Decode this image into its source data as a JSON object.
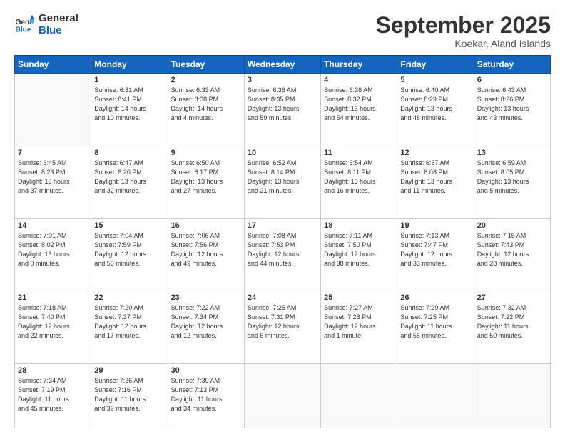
{
  "logo": {
    "line1": "General",
    "line2": "Blue"
  },
  "header": {
    "month": "September 2025",
    "location": "Koekar, Aland Islands"
  },
  "weekdays": [
    "Sunday",
    "Monday",
    "Tuesday",
    "Wednesday",
    "Thursday",
    "Friday",
    "Saturday"
  ],
  "weeks": [
    [
      {
        "day": "",
        "info": ""
      },
      {
        "day": "1",
        "info": "Sunrise: 6:31 AM\nSunset: 8:41 PM\nDaylight: 14 hours\nand 10 minutes."
      },
      {
        "day": "2",
        "info": "Sunrise: 6:33 AM\nSunset: 8:38 PM\nDaylight: 14 hours\nand 4 minutes."
      },
      {
        "day": "3",
        "info": "Sunrise: 6:36 AM\nSunset: 8:35 PM\nDaylight: 13 hours\nand 59 minutes."
      },
      {
        "day": "4",
        "info": "Sunrise: 6:38 AM\nSunset: 8:32 PM\nDaylight: 13 hours\nand 54 minutes."
      },
      {
        "day": "5",
        "info": "Sunrise: 6:40 AM\nSunset: 8:29 PM\nDaylight: 13 hours\nand 48 minutes."
      },
      {
        "day": "6",
        "info": "Sunrise: 6:43 AM\nSunset: 8:26 PM\nDaylight: 13 hours\nand 43 minutes."
      }
    ],
    [
      {
        "day": "7",
        "info": "Sunrise: 6:45 AM\nSunset: 8:23 PM\nDaylight: 13 hours\nand 37 minutes."
      },
      {
        "day": "8",
        "info": "Sunrise: 6:47 AM\nSunset: 8:20 PM\nDaylight: 13 hours\nand 32 minutes."
      },
      {
        "day": "9",
        "info": "Sunrise: 6:50 AM\nSunset: 8:17 PM\nDaylight: 13 hours\nand 27 minutes."
      },
      {
        "day": "10",
        "info": "Sunrise: 6:52 AM\nSunset: 8:14 PM\nDaylight: 13 hours\nand 21 minutes."
      },
      {
        "day": "11",
        "info": "Sunrise: 6:54 AM\nSunset: 8:11 PM\nDaylight: 13 hours\nand 16 minutes."
      },
      {
        "day": "12",
        "info": "Sunrise: 6:57 AM\nSunset: 8:08 PM\nDaylight: 13 hours\nand 11 minutes."
      },
      {
        "day": "13",
        "info": "Sunrise: 6:59 AM\nSunset: 8:05 PM\nDaylight: 13 hours\nand 5 minutes."
      }
    ],
    [
      {
        "day": "14",
        "info": "Sunrise: 7:01 AM\nSunset: 8:02 PM\nDaylight: 13 hours\nand 0 minutes."
      },
      {
        "day": "15",
        "info": "Sunrise: 7:04 AM\nSunset: 7:59 PM\nDaylight: 12 hours\nand 55 minutes."
      },
      {
        "day": "16",
        "info": "Sunrise: 7:06 AM\nSunset: 7:56 PM\nDaylight: 12 hours\nand 49 minutes."
      },
      {
        "day": "17",
        "info": "Sunrise: 7:08 AM\nSunset: 7:53 PM\nDaylight: 12 hours\nand 44 minutes."
      },
      {
        "day": "18",
        "info": "Sunrise: 7:11 AM\nSunset: 7:50 PM\nDaylight: 12 hours\nand 38 minutes."
      },
      {
        "day": "19",
        "info": "Sunrise: 7:13 AM\nSunset: 7:47 PM\nDaylight: 12 hours\nand 33 minutes."
      },
      {
        "day": "20",
        "info": "Sunrise: 7:15 AM\nSunset: 7:43 PM\nDaylight: 12 hours\nand 28 minutes."
      }
    ],
    [
      {
        "day": "21",
        "info": "Sunrise: 7:18 AM\nSunset: 7:40 PM\nDaylight: 12 hours\nand 22 minutes."
      },
      {
        "day": "22",
        "info": "Sunrise: 7:20 AM\nSunset: 7:37 PM\nDaylight: 12 hours\nand 17 minutes."
      },
      {
        "day": "23",
        "info": "Sunrise: 7:22 AM\nSunset: 7:34 PM\nDaylight: 12 hours\nand 12 minutes."
      },
      {
        "day": "24",
        "info": "Sunrise: 7:25 AM\nSunset: 7:31 PM\nDaylight: 12 hours\nand 6 minutes."
      },
      {
        "day": "25",
        "info": "Sunrise: 7:27 AM\nSunset: 7:28 PM\nDaylight: 12 hours\nand 1 minute."
      },
      {
        "day": "26",
        "info": "Sunrise: 7:29 AM\nSunset: 7:25 PM\nDaylight: 11 hours\nand 55 minutes."
      },
      {
        "day": "27",
        "info": "Sunrise: 7:32 AM\nSunset: 7:22 PM\nDaylight: 11 hours\nand 50 minutes."
      }
    ],
    [
      {
        "day": "28",
        "info": "Sunrise: 7:34 AM\nSunset: 7:19 PM\nDaylight: 11 hours\nand 45 minutes."
      },
      {
        "day": "29",
        "info": "Sunrise: 7:36 AM\nSunset: 7:16 PM\nDaylight: 11 hours\nand 39 minutes."
      },
      {
        "day": "30",
        "info": "Sunrise: 7:39 AM\nSunset: 7:13 PM\nDaylight: 11 hours\nand 34 minutes."
      },
      {
        "day": "",
        "info": ""
      },
      {
        "day": "",
        "info": ""
      },
      {
        "day": "",
        "info": ""
      },
      {
        "day": "",
        "info": ""
      }
    ]
  ]
}
